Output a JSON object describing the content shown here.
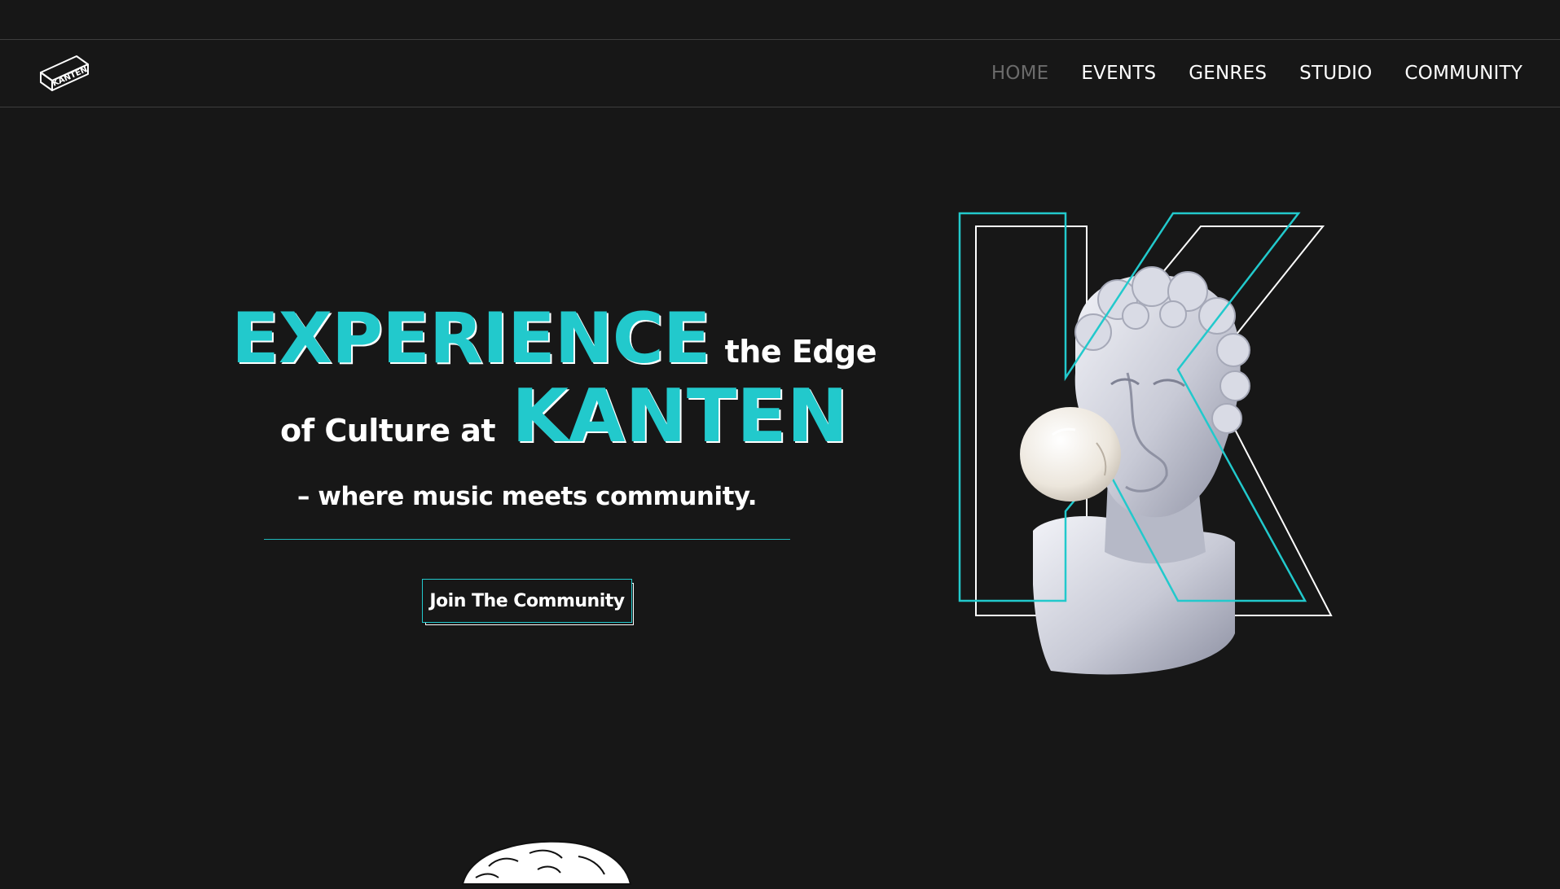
{
  "brand": {
    "logo_icon": "kanten-box-logo",
    "logo_text": "KANTEN"
  },
  "nav": {
    "items": [
      {
        "label": "HOME",
        "active": true
      },
      {
        "label": "EVENTS",
        "active": false
      },
      {
        "label": "GENRES",
        "active": false
      },
      {
        "label": "STUDIO",
        "active": false
      },
      {
        "label": "COMMUNITY",
        "active": false
      }
    ]
  },
  "hero": {
    "line1_accent": "EXPERIENCE",
    "line1_text": "the Edge",
    "line2_text": "of Culture at",
    "line2_accent": "KANTEN",
    "tagline": "– where music meets community.",
    "cta_label": "Join The Community"
  },
  "colors": {
    "background": "#171717",
    "accent": "#22c9cc",
    "text": "#ffffff",
    "nav_active": "#6b6b6b"
  },
  "icons": {
    "hero_image": "statue-bubblegum-k-illustration",
    "footer_sketch": "statue-head-line-sketch"
  }
}
